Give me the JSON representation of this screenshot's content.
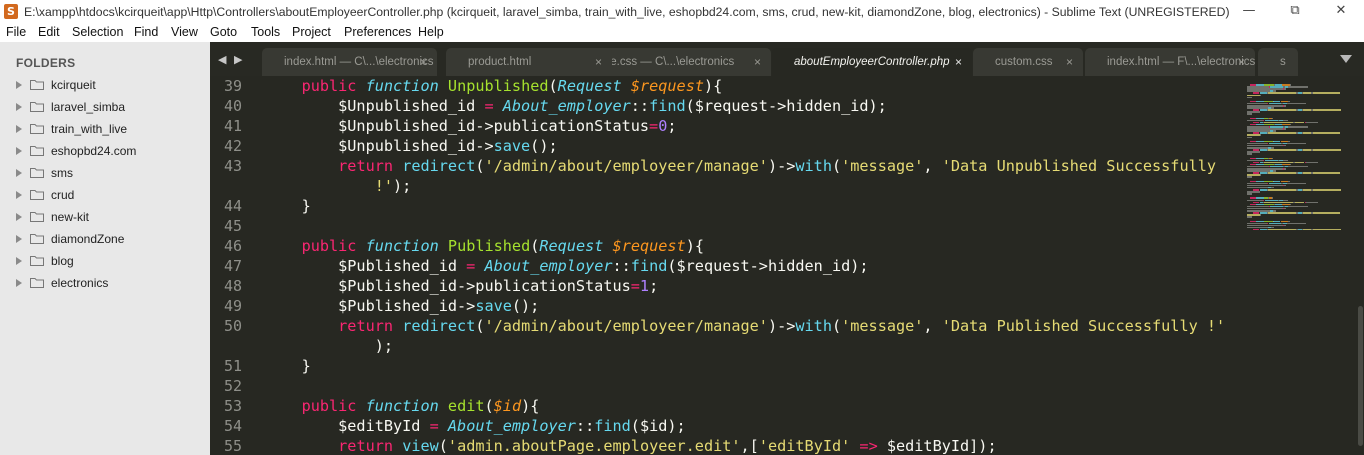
{
  "window": {
    "title": "E:\\xampp\\htdocs\\kcirqueit\\app\\Http\\Controllers\\aboutEmployeerController.php (kcirqueit, laravel_simba, train_with_live, eshopbd24.com, sms, crud, new-kit, diamondZone, blog, electronics) - Sublime Text (UNREGISTERED)",
    "minimize": "—",
    "restore": "⧉",
    "close": "✕",
    "app_icon": "S"
  },
  "menu": [
    "File",
    "Edit",
    "Selection",
    "Find",
    "View",
    "Goto",
    "Tools",
    "Project",
    "Preferences",
    "Help"
  ],
  "sidebar": {
    "header": "FOLDERS",
    "folders": [
      "kcirqueit",
      "laravel_simba",
      "train_with_live",
      "eshopbd24.com",
      "sms",
      "crud",
      "new-kit",
      "diamondZone",
      "blog",
      "electronics"
    ]
  },
  "tabs": {
    "nav_arrows": "◀ ▶",
    "items": [
      {
        "label": "index.html — C\\...\\electronics",
        "close": "×"
      },
      {
        "label": "product.html",
        "close": "×"
      },
      {
        "label": "style.css — C\\...\\electronics",
        "close": "×"
      },
      {
        "label": "aboutEmployeerController.php",
        "close": "×",
        "active": true
      },
      {
        "label": "custom.css",
        "close": "×"
      },
      {
        "label": "index.html — F\\...\\electronics",
        "close": "×"
      },
      {
        "label": "s",
        "close": ""
      }
    ]
  },
  "editor": {
    "lines": [
      {
        "num": "39",
        "tokens": [
          [
            "plain",
            "    "
          ],
          [
            "k",
            "public"
          ],
          [
            "plain",
            " "
          ],
          [
            "bi",
            "function"
          ],
          [
            "plain",
            " "
          ],
          [
            "f",
            "Unpublished"
          ],
          [
            "plain",
            "("
          ],
          [
            "bi",
            "Request"
          ],
          [
            "plain",
            " "
          ],
          [
            "pi",
            "$request"
          ],
          [
            "plain",
            "){"
          ]
        ]
      },
      {
        "num": "40",
        "tokens": [
          [
            "plain",
            "        $Unpublished_id "
          ],
          [
            "k",
            "="
          ],
          [
            "plain",
            " "
          ],
          [
            "bi",
            "About_employer"
          ],
          [
            "plain",
            "::"
          ],
          [
            "b",
            "find"
          ],
          [
            "plain",
            "($request->hidden_id);"
          ]
        ]
      },
      {
        "num": "41",
        "tokens": [
          [
            "plain",
            "        $Unpublished_id->publicationStatus"
          ],
          [
            "k",
            "="
          ],
          [
            "n",
            "0"
          ],
          [
            "plain",
            ";"
          ]
        ]
      },
      {
        "num": "42",
        "tokens": [
          [
            "plain",
            "        $Unpublished_id->"
          ],
          [
            "b",
            "save"
          ],
          [
            "plain",
            "();"
          ]
        ]
      },
      {
        "num": "43",
        "tokens": [
          [
            "plain",
            "        "
          ],
          [
            "k",
            "return"
          ],
          [
            "plain",
            " "
          ],
          [
            "b",
            "redirect"
          ],
          [
            "plain",
            "("
          ],
          [
            "s",
            "'/admin/about/employeer/manage'"
          ],
          [
            "plain",
            ")->"
          ],
          [
            "b",
            "with"
          ],
          [
            "plain",
            "("
          ],
          [
            "s",
            "'message'"
          ],
          [
            "plain",
            ", "
          ],
          [
            "s",
            "'Data Unpublished Successfully"
          ]
        ]
      },
      {
        "num": "",
        "tokens": [
          [
            "s",
            "            !'"
          ],
          [
            "plain",
            ");"
          ]
        ]
      },
      {
        "num": "44",
        "tokens": [
          [
            "plain",
            "    }"
          ]
        ]
      },
      {
        "num": "45",
        "tokens": []
      },
      {
        "num": "46",
        "tokens": [
          [
            "plain",
            "    "
          ],
          [
            "k",
            "public"
          ],
          [
            "plain",
            " "
          ],
          [
            "bi",
            "function"
          ],
          [
            "plain",
            " "
          ],
          [
            "f",
            "Published"
          ],
          [
            "plain",
            "("
          ],
          [
            "bi",
            "Request"
          ],
          [
            "plain",
            " "
          ],
          [
            "pi",
            "$request"
          ],
          [
            "plain",
            "){"
          ]
        ]
      },
      {
        "num": "47",
        "tokens": [
          [
            "plain",
            "        $Published_id "
          ],
          [
            "k",
            "="
          ],
          [
            "plain",
            " "
          ],
          [
            "bi",
            "About_employer"
          ],
          [
            "plain",
            "::"
          ],
          [
            "b",
            "find"
          ],
          [
            "plain",
            "($request->hidden_id);"
          ]
        ]
      },
      {
        "num": "48",
        "tokens": [
          [
            "plain",
            "        $Published_id->publicationStatus"
          ],
          [
            "k",
            "="
          ],
          [
            "n",
            "1"
          ],
          [
            "plain",
            ";"
          ]
        ]
      },
      {
        "num": "49",
        "tokens": [
          [
            "plain",
            "        $Published_id->"
          ],
          [
            "b",
            "save"
          ],
          [
            "plain",
            "();"
          ]
        ]
      },
      {
        "num": "50",
        "tokens": [
          [
            "plain",
            "        "
          ],
          [
            "k",
            "return"
          ],
          [
            "plain",
            " "
          ],
          [
            "b",
            "redirect"
          ],
          [
            "plain",
            "("
          ],
          [
            "s",
            "'/admin/about/employeer/manage'"
          ],
          [
            "plain",
            ")->"
          ],
          [
            "b",
            "with"
          ],
          [
            "plain",
            "("
          ],
          [
            "s",
            "'message'"
          ],
          [
            "plain",
            ", "
          ],
          [
            "s",
            "'Data Published Successfully !'"
          ]
        ]
      },
      {
        "num": "",
        "tokens": [
          [
            "plain",
            "            );"
          ]
        ]
      },
      {
        "num": "51",
        "tokens": [
          [
            "plain",
            "    }"
          ]
        ]
      },
      {
        "num": "52",
        "tokens": []
      },
      {
        "num": "53",
        "tokens": [
          [
            "plain",
            "    "
          ],
          [
            "k",
            "public"
          ],
          [
            "plain",
            " "
          ],
          [
            "bi",
            "function"
          ],
          [
            "plain",
            " "
          ],
          [
            "f",
            "edit"
          ],
          [
            "plain",
            "("
          ],
          [
            "pi",
            "$id"
          ],
          [
            "plain",
            "){"
          ]
        ]
      },
      {
        "num": "54",
        "tokens": [
          [
            "plain",
            "        $editById "
          ],
          [
            "k",
            "="
          ],
          [
            "plain",
            " "
          ],
          [
            "bi",
            "About_employer"
          ],
          [
            "plain",
            "::"
          ],
          [
            "b",
            "find"
          ],
          [
            "plain",
            "($id);"
          ]
        ]
      },
      {
        "num": "55",
        "tokens": [
          [
            "plain",
            "        "
          ],
          [
            "k",
            "return"
          ],
          [
            "plain",
            " "
          ],
          [
            "b",
            "view"
          ],
          [
            "plain",
            "("
          ],
          [
            "s",
            "'admin.aboutPage.employeer.edit'"
          ],
          [
            "plain",
            ",["
          ],
          [
            "s",
            "'editById'"
          ],
          [
            "plain",
            " "
          ],
          [
            "k",
            "=>"
          ],
          [
            "plain",
            " $editById]);"
          ]
        ]
      }
    ]
  },
  "colors": {
    "editor_bg": "#272822",
    "keyword": "#f92672",
    "string": "#e6db74",
    "function_name": "#a6e22e",
    "number": "#ae81ff",
    "builtin": "#66d9ef",
    "param": "#fd971f",
    "text": "#f8f8f2",
    "gutter": "#8f908a"
  }
}
